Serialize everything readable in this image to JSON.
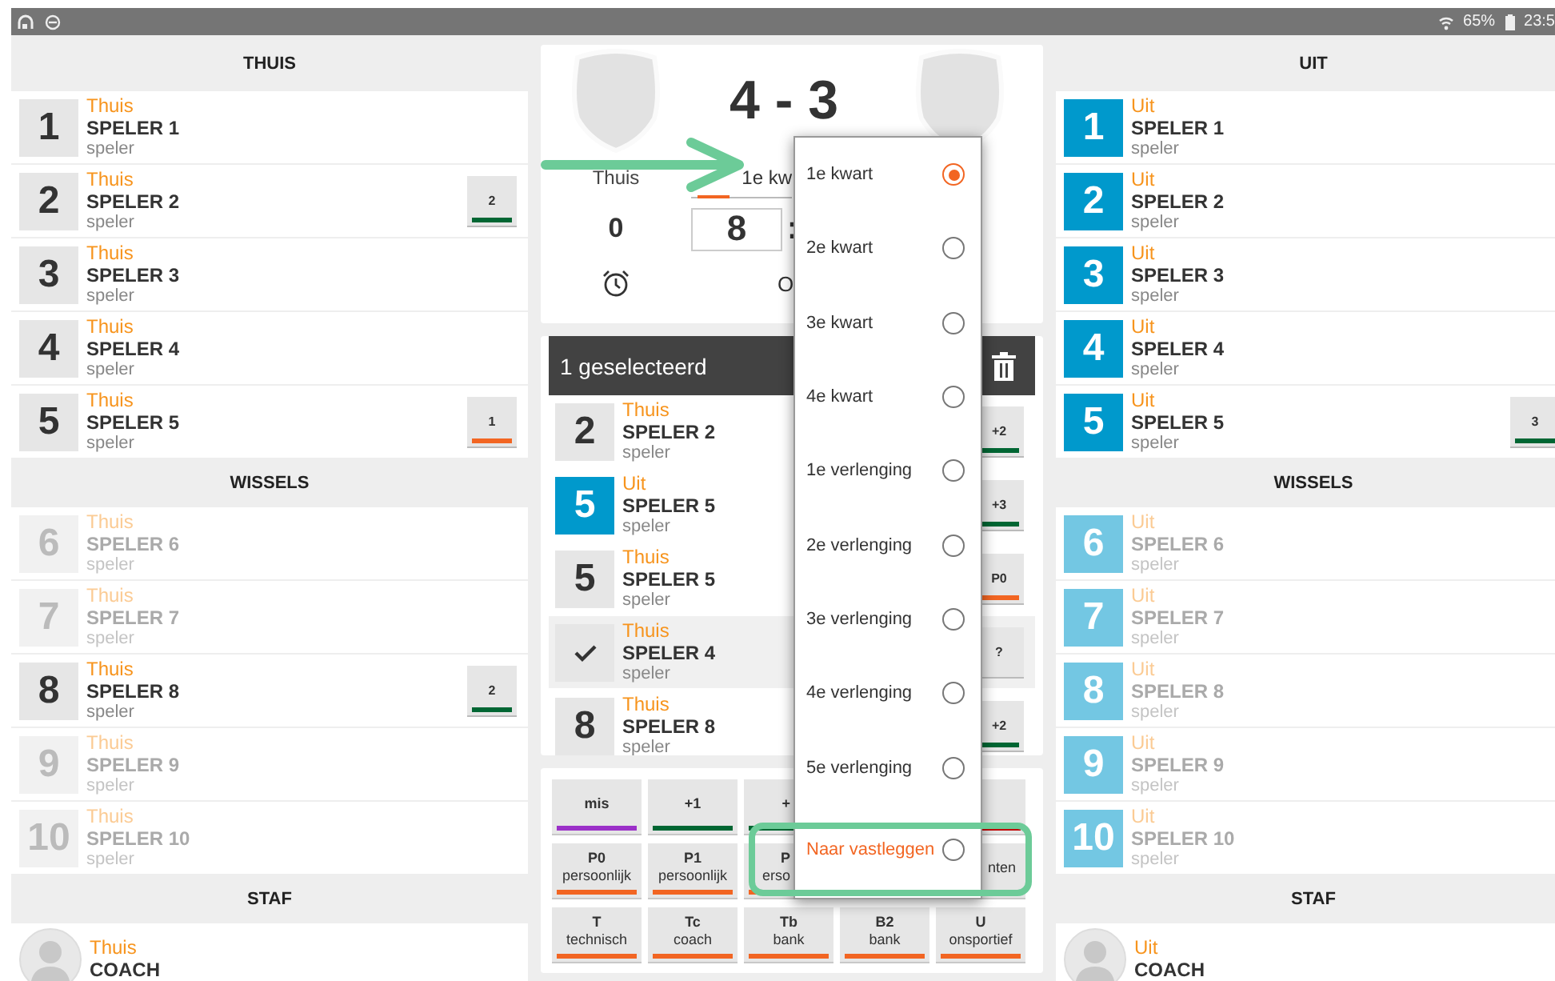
{
  "status_bar": {
    "battery": "65%",
    "time": "23:5"
  },
  "columns": [
    {
      "color": "#e6e6e6",
      "sections": [
        {
          "kind": "players",
          "title": "THUIS",
          "players": [
            {
              "number": "1",
              "team": "Thuis",
              "name": "SPELER 1",
              "role": "speler",
              "active": true
            },
            {
              "number": "2",
              "team": "Thuis",
              "name": "SPELER 2",
              "role": "speler",
              "active": true,
              "stat": {
                "text": "2",
                "color": "#006633"
              }
            },
            {
              "number": "3",
              "team": "Thuis",
              "name": "SPELER 3",
              "role": "speler",
              "active": true
            },
            {
              "number": "4",
              "team": "Thuis",
              "name": "SPELER 4",
              "role": "speler",
              "active": true
            },
            {
              "number": "5",
              "team": "Thuis",
              "name": "SPELER 5",
              "role": "speler",
              "active": true,
              "stat": {
                "text": "1",
                "color": "#f26522"
              }
            }
          ]
        },
        {
          "kind": "players",
          "title": "WISSELS",
          "players": [
            {
              "number": "6",
              "team": "Thuis",
              "name": "SPELER 6",
              "role": "speler",
              "active": false
            },
            {
              "number": "7",
              "team": "Thuis",
              "name": "SPELER 7",
              "role": "speler",
              "active": false
            },
            {
              "number": "8",
              "team": "Thuis",
              "name": "SPELER 8",
              "role": "speler",
              "active": true,
              "stat": {
                "text": "2",
                "color": "#006633"
              }
            },
            {
              "number": "9",
              "team": "Thuis",
              "name": "SPELER 9",
              "role": "speler",
              "active": false
            },
            {
              "number": "10",
              "team": "Thuis",
              "name": "SPELER 10",
              "role": "speler",
              "active": false
            }
          ]
        },
        {
          "kind": "staff",
          "title": "STAF",
          "members": [
            {
              "team": "Thuis",
              "name": "COACH"
            }
          ]
        }
      ]
    },
    {
      "color": "#0099cc",
      "sections": [
        {
          "kind": "players",
          "title": "UIT",
          "players": [
            {
              "number": "1",
              "team": "Uit",
              "name": "SPELER 1",
              "role": "speler",
              "active": true
            },
            {
              "number": "2",
              "team": "Uit",
              "name": "SPELER 2",
              "role": "speler",
              "active": true
            },
            {
              "number": "3",
              "team": "Uit",
              "name": "SPELER 3",
              "role": "speler",
              "active": true
            },
            {
              "number": "4",
              "team": "Uit",
              "name": "SPELER 4",
              "role": "speler",
              "active": true
            },
            {
              "number": "5",
              "team": "Uit",
              "name": "SPELER 5",
              "role": "speler",
              "active": true,
              "stat": {
                "text": "3",
                "color": "#006633"
              }
            }
          ]
        },
        {
          "kind": "players",
          "title": "WISSELS",
          "players": [
            {
              "number": "6",
              "team": "Uit",
              "name": "SPELER 6",
              "role": "speler",
              "active": false
            },
            {
              "number": "7",
              "team": "Uit",
              "name": "SPELER 7",
              "role": "speler",
              "active": false
            },
            {
              "number": "8",
              "team": "Uit",
              "name": "SPELER 8",
              "role": "speler",
              "active": false
            },
            {
              "number": "9",
              "team": "Uit",
              "name": "SPELER 9",
              "role": "speler",
              "active": false
            },
            {
              "number": "10",
              "team": "Uit",
              "name": "SPELER 10",
              "role": "speler",
              "active": false
            }
          ]
        },
        {
          "kind": "staff",
          "title": "STAF",
          "members": [
            {
              "team": "Uit",
              "name": "COACH"
            }
          ]
        }
      ]
    }
  ],
  "score_card": {
    "score": "4 - 3",
    "home_label": "Thuis",
    "period": "1e kw",
    "home_fouls": "0",
    "timer_minutes": "8",
    "timer_separator": ":",
    "status_text": "O"
  },
  "selection": {
    "title": "1 geselecteerd",
    "rows": [
      {
        "color": "#e6e6e6",
        "number": "2",
        "team": "Thuis",
        "name": "SPELER 2",
        "role": "speler",
        "selected": false,
        "stat": {
          "text": "+2",
          "color": "#006633"
        }
      },
      {
        "color": "#0099cc",
        "number": "5",
        "team": "Uit",
        "name": "SPELER 5",
        "role": "speler",
        "selected": false,
        "stat": {
          "text": "+3",
          "color": "#006633"
        }
      },
      {
        "color": "#e6e6e6",
        "number": "5",
        "team": "Thuis",
        "name": "SPELER 5",
        "role": "speler",
        "selected": false,
        "stat": {
          "text": "P0",
          "color": "#f26522"
        }
      },
      {
        "color": "#e6e6e6",
        "team": "Thuis",
        "name": "SPELER 4",
        "role": "speler",
        "selected": true,
        "stat": {
          "text": "?"
        }
      },
      {
        "color": "#e6e6e6",
        "number": "8",
        "team": "Thuis",
        "name": "SPELER 8",
        "role": "speler",
        "selected": false,
        "stat": {
          "text": "+2",
          "color": "#006633"
        }
      }
    ]
  },
  "action_buttons": [
    {
      "kind": "button",
      "label": "mis",
      "color": "#9b30c8"
    },
    {
      "kind": "button",
      "label": "+1",
      "color": "#006633"
    },
    {
      "kind": "cut_right",
      "label": "+",
      "color": "#006633"
    },
    {
      "kind": "covered"
    },
    {
      "kind": "cut_left",
      "color": "#c00000"
    },
    {
      "kind": "button",
      "label": "P0",
      "sub": "persoonlijk",
      "color": "#f26522"
    },
    {
      "kind": "button",
      "label": "P1",
      "sub": "persoonlijk",
      "color": "#f26522"
    },
    {
      "kind": "cut_right",
      "label": "P",
      "sub": "erso",
      "color": "#f26522"
    },
    {
      "kind": "covered"
    },
    {
      "kind": "cut_left",
      "sub": "nten"
    },
    {
      "kind": "button",
      "label": "T",
      "sub": "technisch",
      "color": "#f26522"
    },
    {
      "kind": "button",
      "label": "Tc",
      "sub": "coach",
      "color": "#f26522"
    },
    {
      "kind": "button",
      "label": "Tb",
      "sub": "bank",
      "color": "#f26522"
    },
    {
      "kind": "button",
      "label": "B2",
      "sub": "bank",
      "color": "#f26522"
    },
    {
      "kind": "button",
      "label": "U",
      "sub": "onsportief",
      "color": "#f26522"
    }
  ],
  "period_menu": [
    {
      "kind": "option",
      "label": "1e kwart",
      "selected": true
    },
    {
      "kind": "option",
      "label": "2e kwart",
      "selected": false
    },
    {
      "kind": "option",
      "label": "3e kwart",
      "selected": false
    },
    {
      "kind": "option",
      "label": "4e kwart",
      "selected": false
    },
    {
      "kind": "option",
      "label": "1e verlenging",
      "selected": false
    },
    {
      "kind": "option",
      "label": "2e verlenging",
      "selected": false
    },
    {
      "kind": "option",
      "label": "3e verlenging",
      "selected": false
    },
    {
      "kind": "option",
      "label": "4e verlenging",
      "selected": false
    },
    {
      "kind": "option",
      "label": "5e verlenging",
      "selected": false
    },
    {
      "kind": "action",
      "label": "Naar vastleggen",
      "selected": false
    }
  ]
}
